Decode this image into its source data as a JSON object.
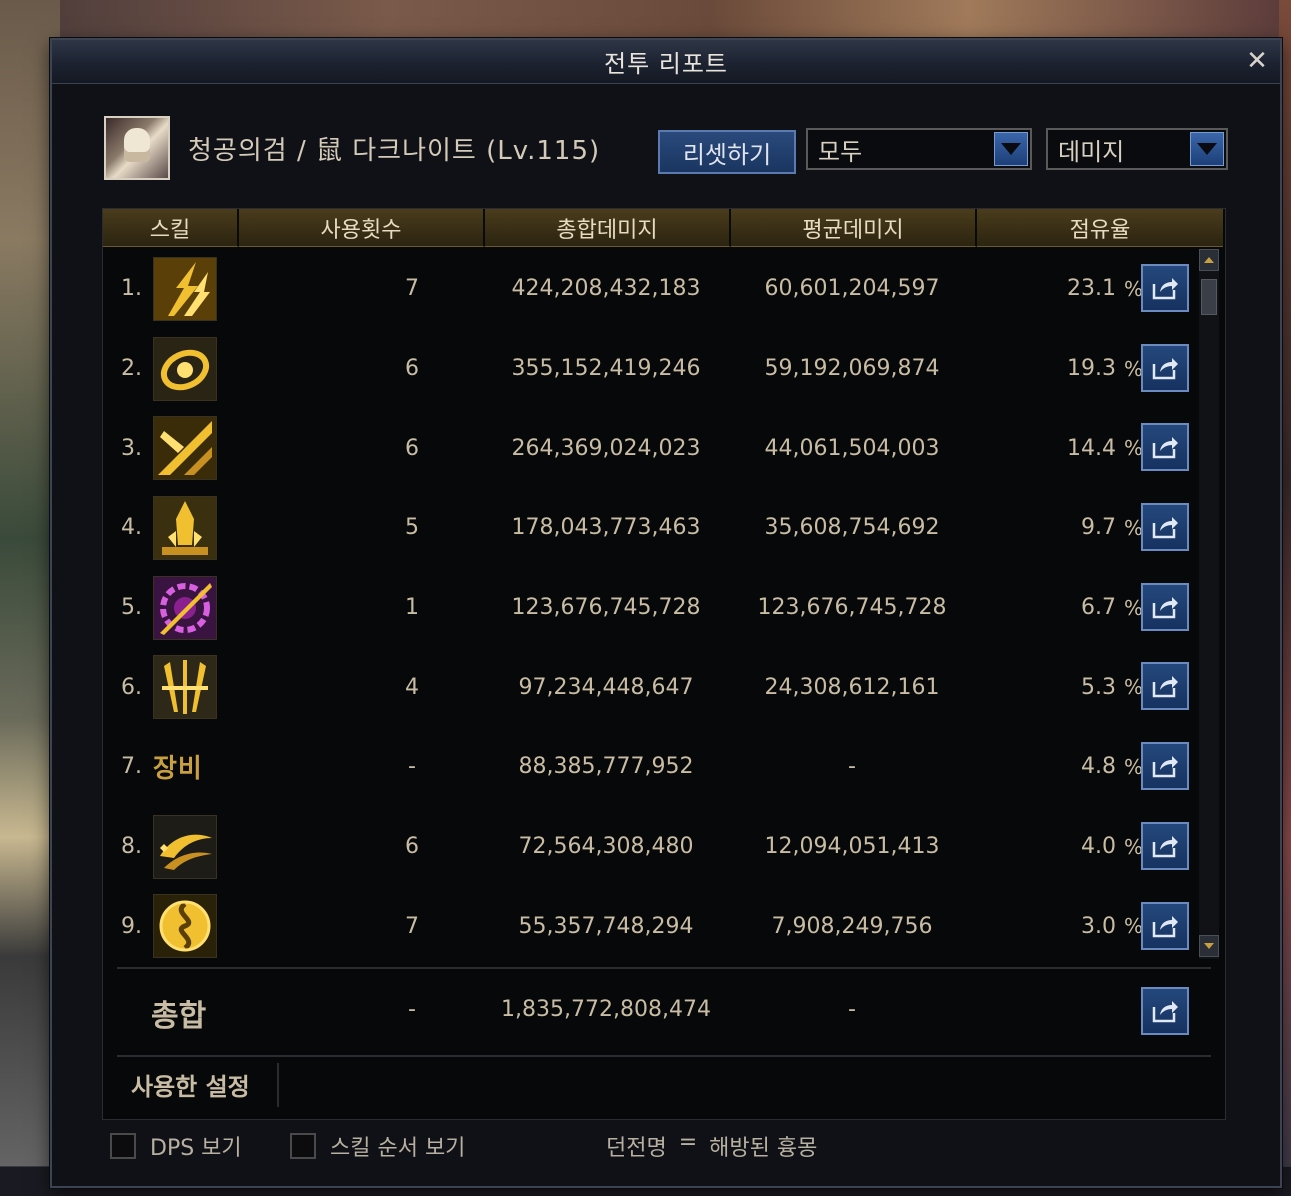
{
  "window": {
    "title": "전투 리포트"
  },
  "character": {
    "name": "청공의검 / 鼠 다크나이트 (Lv.115)"
  },
  "controls": {
    "reset_label": "리셋하기",
    "filter_value": "모두",
    "metric_value": "데미지"
  },
  "table": {
    "headers": {
      "skill": "스킬",
      "uses": "사용횟수",
      "total": "총합데미지",
      "avg": "평균데미지",
      "share": "점유율"
    },
    "rows": [
      {
        "rank": "1.",
        "icon": "lightning-skill-icon",
        "uses": "7",
        "total": "424,208,432,183",
        "avg": "60,601,204,597",
        "share": "23.1",
        "pct": "%"
      },
      {
        "rank": "2.",
        "icon": "swirl-skill-icon",
        "uses": "6",
        "total": "355,152,419,246",
        "avg": "59,192,069,874",
        "share": "19.3",
        "pct": "%"
      },
      {
        "rank": "3.",
        "icon": "slash-skill-icon",
        "uses": "6",
        "total": "264,369,024,023",
        "avg": "44,061,504,003",
        "share": "14.4",
        "pct": "%"
      },
      {
        "rank": "4.",
        "icon": "crystal-skill-icon",
        "uses": "5",
        "total": "178,043,773,463",
        "avg": "35,608,754,692",
        "share": "9.7",
        "pct": "%"
      },
      {
        "rank": "5.",
        "icon": "purple-gear-skill-icon",
        "uses": "1",
        "total": "123,676,745,728",
        "avg": "123,676,745,728",
        "share": "6.7",
        "pct": "%"
      },
      {
        "rank": "6.",
        "icon": "claw-skill-icon",
        "uses": "4",
        "total": "97,234,448,647",
        "avg": "24,308,612,161",
        "share": "5.3",
        "pct": "%"
      },
      {
        "rank": "7.",
        "equip_label": "장비",
        "uses": "-",
        "total": "88,385,777,952",
        "avg": "-",
        "share": "4.8",
        "pct": "%"
      },
      {
        "rank": "8.",
        "icon": "wave-skill-icon",
        "uses": "6",
        "total": "72,564,308,480",
        "avg": "12,094,051,413",
        "share": "4.0",
        "pct": "%"
      },
      {
        "rank": "9.",
        "icon": "orb-skill-icon",
        "uses": "7",
        "total": "55,357,748,294",
        "avg": "7,908,249,756",
        "share": "3.0",
        "pct": "%"
      }
    ],
    "summary": {
      "label": "총합",
      "uses": "-",
      "total": "1,835,772,808,474",
      "avg": "-"
    },
    "settings_label": "사용한 설정"
  },
  "footer": {
    "dps_label": "DPS 보기",
    "order_label": "스킬 순서 보기",
    "dungeon_key": "던전명",
    "dungeon_eq": "=",
    "dungeon_value": "해방된 흉몽"
  },
  "colors": {
    "accent_blue": "#24487c",
    "header_gold": "#4a3c1c",
    "text": "#c8bca4",
    "skill_gold": "#e8b830",
    "skill_purple": "#b040c0"
  }
}
